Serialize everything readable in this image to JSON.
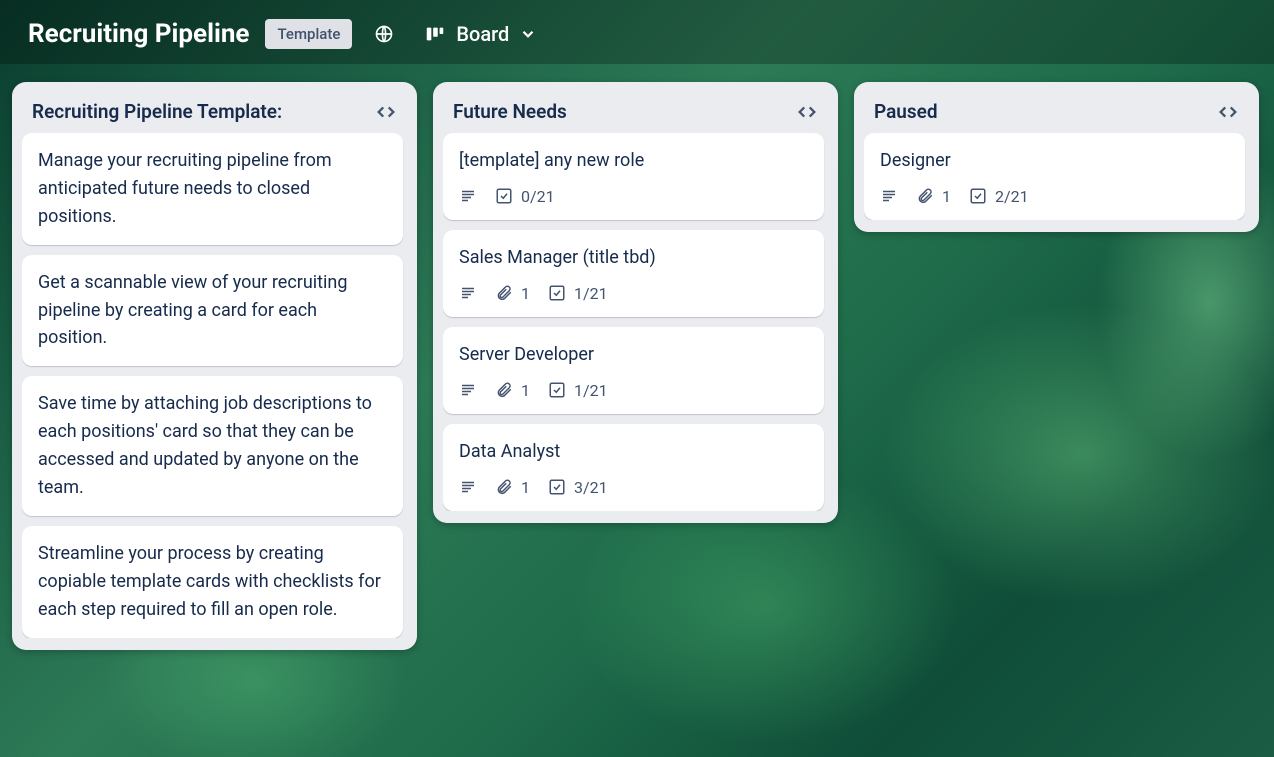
{
  "header": {
    "title": "Recruiting Pipeline",
    "badge": "Template",
    "view_label": "Board"
  },
  "lists": [
    {
      "title": "Recruiting Pipeline Template:",
      "cards": [
        {
          "title": "Manage your recruiting pipeline from anticipated future needs to closed positions."
        },
        {
          "title": "Get a scannable view of your recruiting pipeline by creating a card for each position."
        },
        {
          "title": "Save time by attaching job descriptions to each positions' card so that they can be accessed and updated by anyone on the team."
        },
        {
          "title": "Streamline your process by creating copiable template cards with checklists for each step required to fill an open role."
        }
      ]
    },
    {
      "title": "Future Needs",
      "cards": [
        {
          "title": "[template] any new role",
          "desc": true,
          "checklist": "0/21"
        },
        {
          "title": "Sales Manager (title tbd)",
          "desc": true,
          "attachments": "1",
          "checklist": "1/21"
        },
        {
          "title": "Server Developer",
          "desc": true,
          "attachments": "1",
          "checklist": "1/21"
        },
        {
          "title": "Data Analyst",
          "desc": true,
          "attachments": "1",
          "checklist": "3/21"
        }
      ]
    },
    {
      "title": "Paused",
      "cards": [
        {
          "title": "Designer",
          "desc": true,
          "attachments": "1",
          "checklist": "2/21"
        }
      ]
    }
  ]
}
